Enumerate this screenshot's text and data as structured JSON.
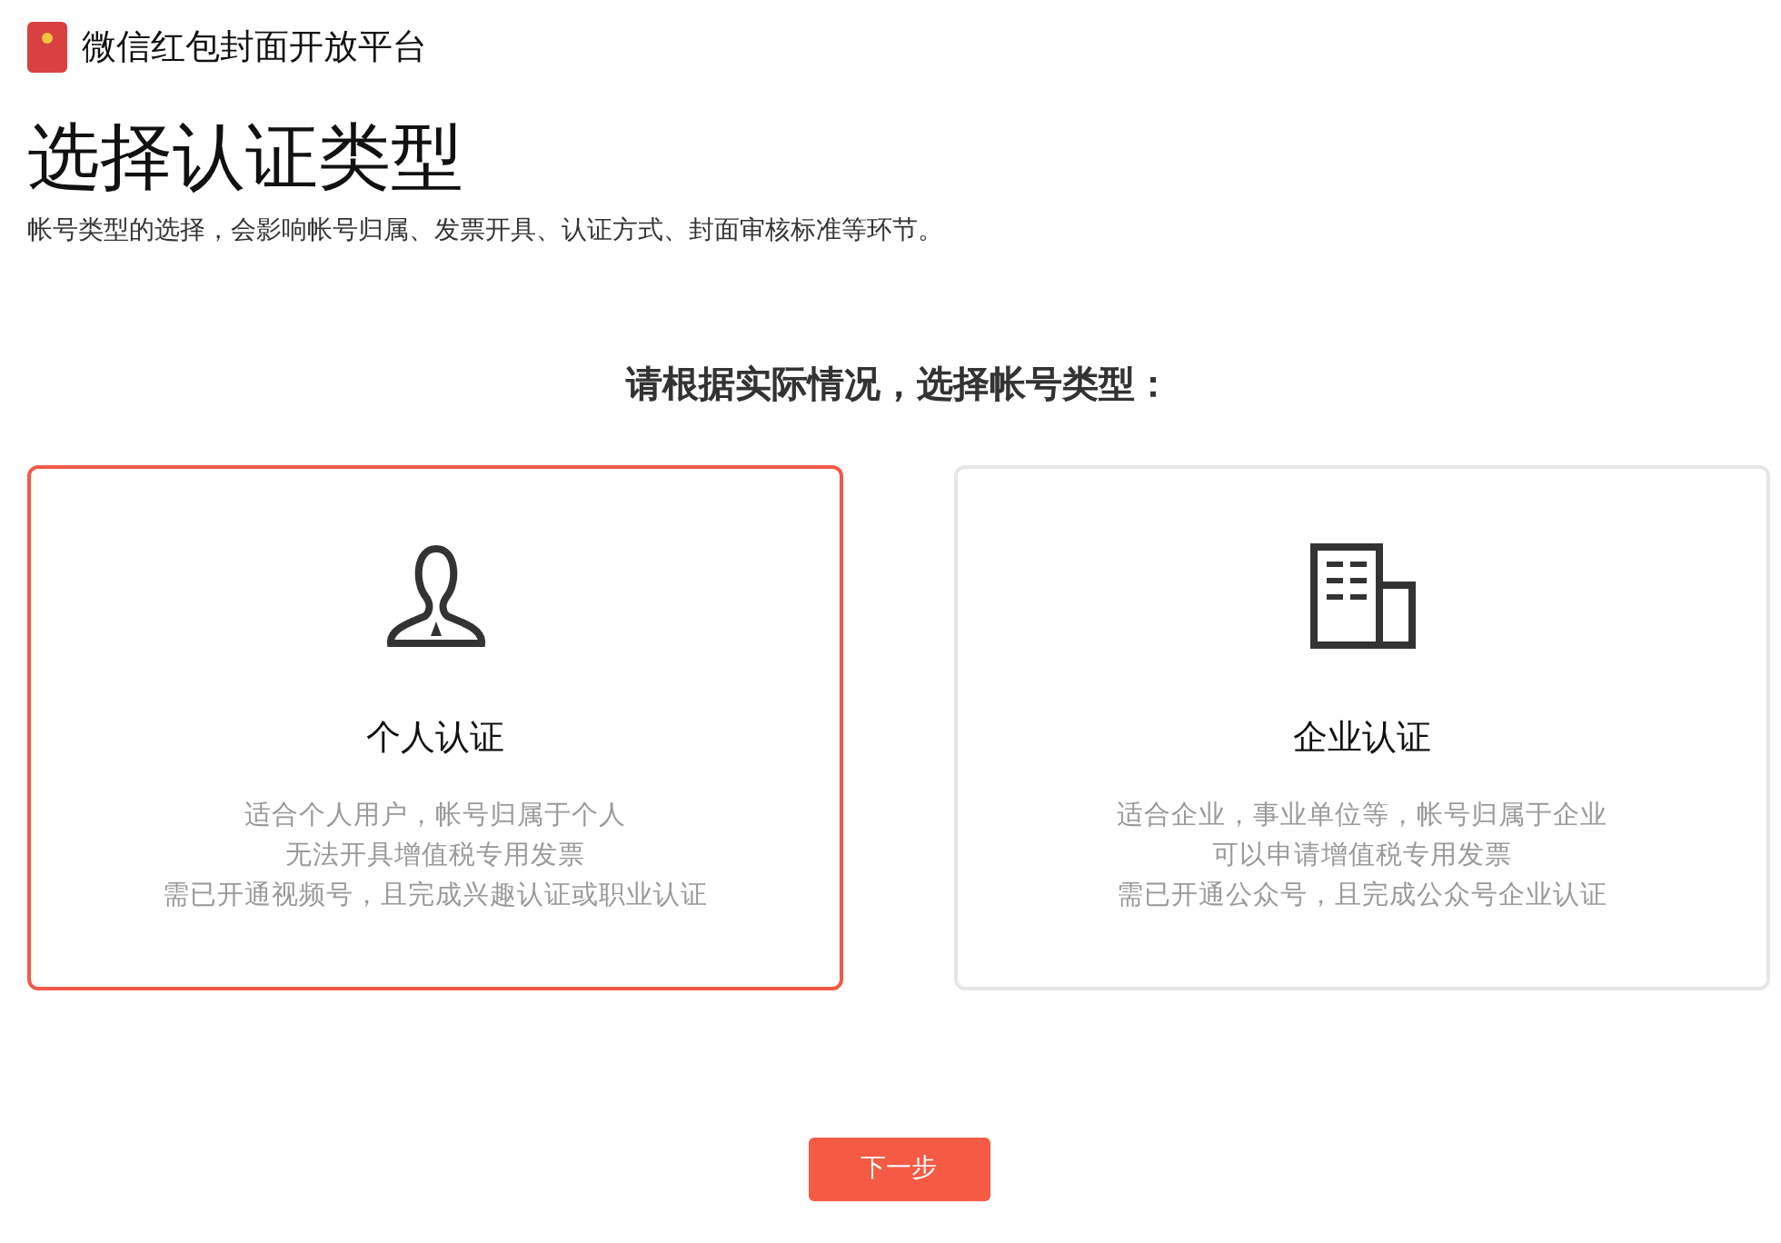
{
  "brand": {
    "title": "微信红包封面开放平台"
  },
  "page": {
    "title": "选择认证类型",
    "subtitle": "帐号类型的选择，会影响帐号归属、发票开具、认证方式、封面审核标准等环节。"
  },
  "prompt": "请根据实际情况，选择帐号类型：",
  "options": [
    {
      "kind": "person",
      "title": "个人认证",
      "selected": true,
      "lines": [
        "适合个人用户，帐号归属于个人",
        "无法开具增值税专用发票",
        "需已开通视频号，且完成兴趣认证或职业认证"
      ]
    },
    {
      "kind": "company",
      "title": "企业认证",
      "selected": false,
      "lines": [
        "适合企业，事业单位等，帐号归属于企业",
        "可以申请增值税专用发票",
        "需已开通公众号，且完成公众号企业认证"
      ]
    }
  ],
  "next_button": "下一步"
}
